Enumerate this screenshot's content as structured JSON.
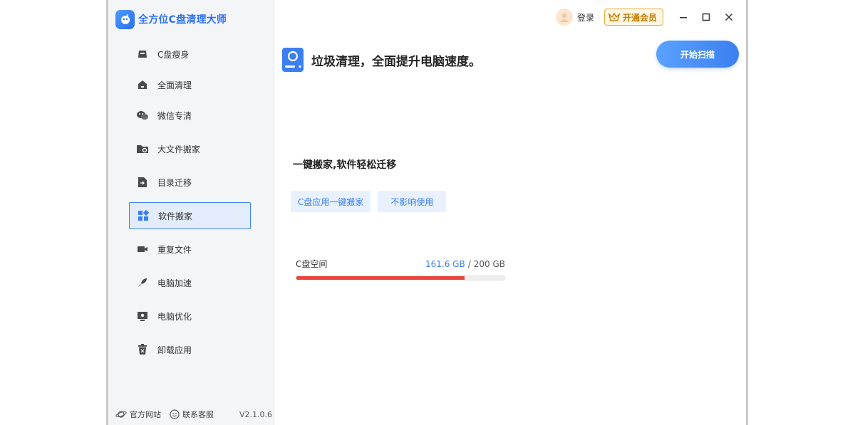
{
  "app": {
    "title": "全方位C盘清理大师",
    "version": "V2.1.0.6"
  },
  "sidebar": {
    "items": [
      {
        "label": "C盘瘦身",
        "icon": "broom-icon"
      },
      {
        "label": "全面清理",
        "icon": "home-icon"
      },
      {
        "label": "微信专清",
        "icon": "wechat-icon"
      },
      {
        "label": "大文件搬家",
        "icon": "folder-search-icon"
      },
      {
        "label": "目录迁移",
        "icon": "file-move-icon"
      },
      {
        "label": "软件搬家",
        "icon": "apps-icon",
        "active": true
      },
      {
        "label": "重复文件",
        "icon": "video-icon"
      },
      {
        "label": "电脑加速",
        "icon": "rocket-icon"
      },
      {
        "label": "电脑优化",
        "icon": "monitor-gear-icon"
      },
      {
        "label": "卸载应用",
        "icon": "trash-icon"
      }
    ]
  },
  "footer": {
    "website": "官方网站",
    "support": "联系客服"
  },
  "topbar": {
    "login": "登录",
    "vip": "开通会员"
  },
  "main": {
    "headline": "垃圾清理，全面提升电脑速度。",
    "scan_button": "开始扫描",
    "section_title": "一键搬家,软件轻松迁移",
    "tags": [
      "C盘应用一键搬家",
      "不影响使用"
    ],
    "disk": {
      "label": "C盘空间",
      "used": "161.6 GB",
      "separator": "/",
      "total": "200 GB",
      "used_fraction": 0.808
    }
  },
  "colors": {
    "accent": "#3b7ff0",
    "danger": "#e8453a",
    "vip": "#e5a93b"
  }
}
